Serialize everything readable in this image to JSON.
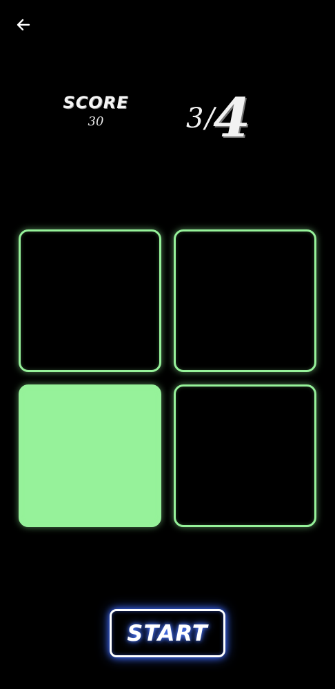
{
  "header": {
    "back_icon": "arrow-left-icon"
  },
  "score": {
    "label": "SCORE",
    "value": "30"
  },
  "round": {
    "current": "3",
    "separator": "/",
    "total": "4"
  },
  "board": {
    "tiles": [
      {
        "state": "off"
      },
      {
        "state": "off"
      },
      {
        "state": "lit"
      },
      {
        "state": "off"
      }
    ]
  },
  "controls": {
    "start_label": "START"
  },
  "colors": {
    "background": "#000000",
    "tile_accent": "#96f29a",
    "start_glow": "#3f6cff"
  }
}
